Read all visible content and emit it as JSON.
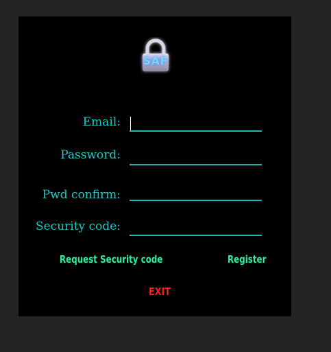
{
  "logo": {
    "text": "SAF",
    "icon": "padlock-icon"
  },
  "form": {
    "email_label": "Email:",
    "password_label": "Password:",
    "pwd_confirm_label": "Pwd confirm:",
    "security_code_label": "Security code:",
    "email_value": "",
    "password_value": "",
    "pwd_confirm_value": "",
    "security_code_value": ""
  },
  "actions": {
    "request_code_label": "Request Security code",
    "register_label": "Register",
    "exit_label": "EXIT"
  },
  "colors": {
    "panel_bg": "#000000",
    "outer_bg": "#232323",
    "label": "#1fc9c9",
    "link": "#28f0a0",
    "exit": "#ff1a1a"
  }
}
